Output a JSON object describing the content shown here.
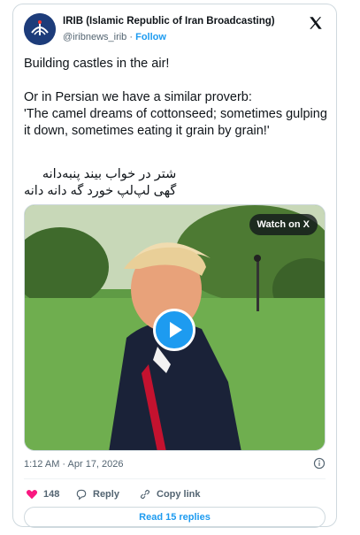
{
  "header": {
    "name": "IRIB (Islamic Republic of Iran Broadcasting)",
    "handle": "@iribnews_irib",
    "separator": " · ",
    "follow_label": "Follow",
    "avatar_icon": "irib-logo-icon",
    "close_icon": "x-logo-icon"
  },
  "tweet": {
    "text": "Building castles in the air!\n\nOr in Persian we have a similar proverb:\n'The camel dreams of cottonseed; sometimes gulping it down, sometimes eating it grain by grain!'",
    "persian": "شتر در خواب بیند پنبه‌دانه\nگهی لپ‌لپ خورد گه دانه دانه"
  },
  "media": {
    "watch_label": "Watch on X",
    "play_icon": "play-icon"
  },
  "meta": {
    "timestamp": "1:12 AM · Apr 17, 2026",
    "info_icon": "info-icon"
  },
  "actions": {
    "like_count": "148",
    "reply_label": "Reply",
    "copy_label": "Copy link",
    "read_replies_label": "Read 15 replies"
  },
  "colors": {
    "accent": "#1d9bf0",
    "like": "#f91880",
    "muted": "#536471"
  }
}
